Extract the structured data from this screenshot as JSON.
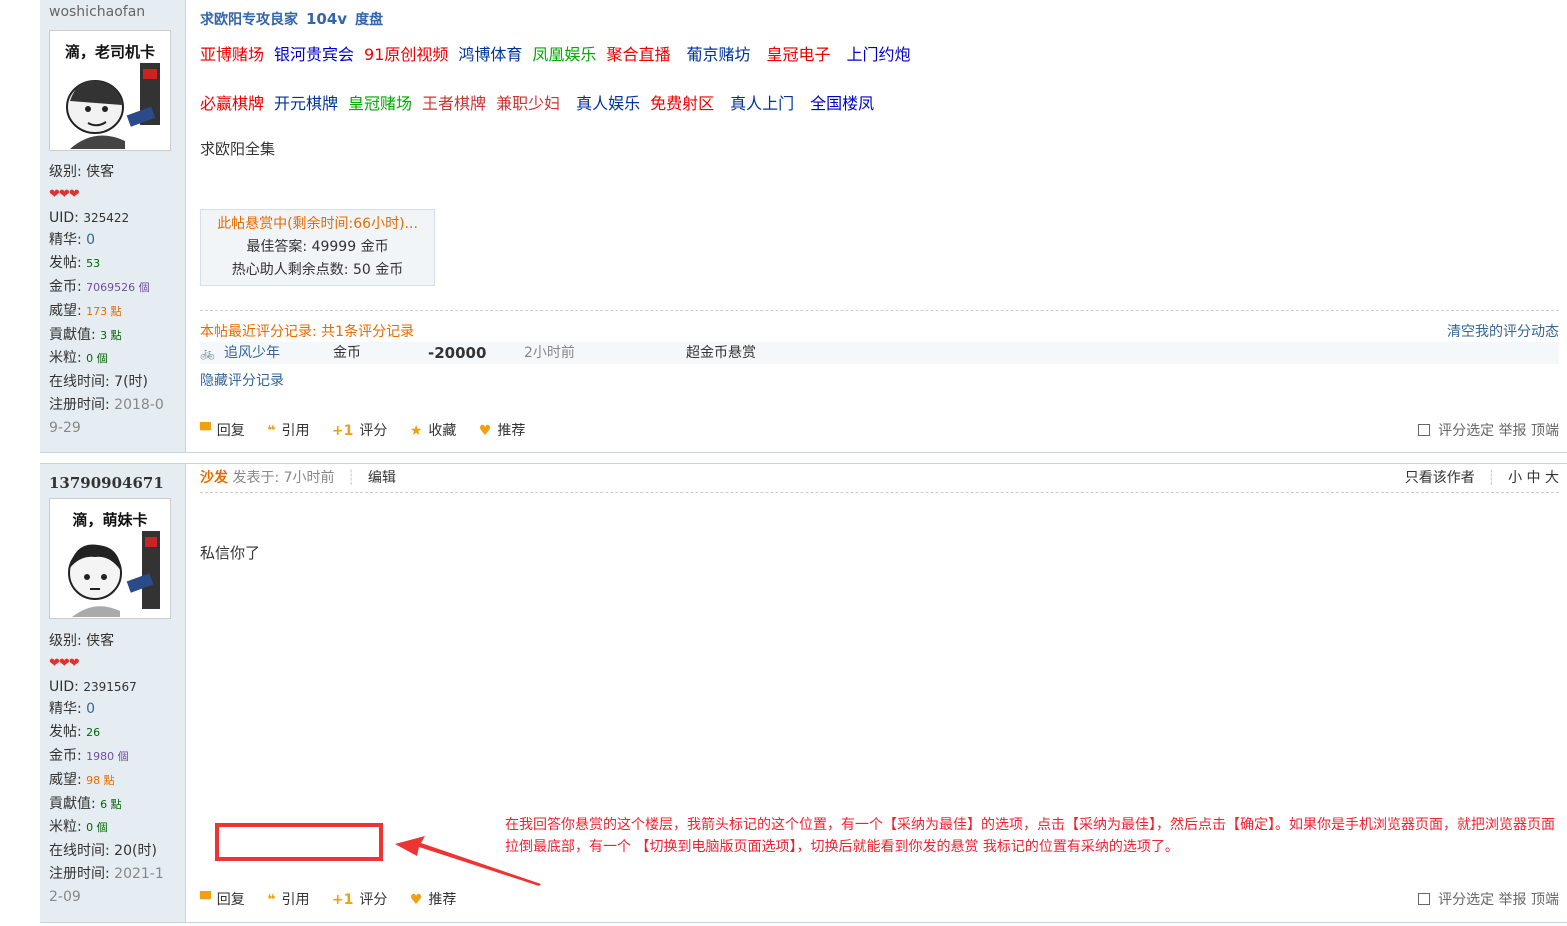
{
  "post1": {
    "username": "woshichaofan",
    "avatar_caption": "滴，老司机卡",
    "stats": {
      "level_label": "级别:",
      "level": "侠客",
      "hearts": "❤❤❤",
      "uid_label": "UID:",
      "uid": "325422",
      "elite_label": "精华:",
      "elite": "0",
      "posts_label": "发帖:",
      "posts": "53",
      "gold_label": "金币:",
      "gold": "7069526 個",
      "prestige_label": "威望:",
      "prestige": "173 點",
      "contrib_label": "貢獻值:",
      "contrib": "3 點",
      "rice_label": "米粒:",
      "rice": "0 個",
      "online_label": "在线时间:",
      "online": "7(时)",
      "reg_label": "注册时间:",
      "reg_part1": "2018-0",
      "reg_part2": "9-29"
    },
    "title": {
      "a": "求欧阳专攻良家",
      "b": "104v",
      "c": "度盘"
    },
    "ads_row1": [
      "亚博赌场",
      "银河贵宾会",
      "91原创视频",
      "鸿博体育",
      "凤凰娱乐",
      "聚合直播",
      "葡京赌坊",
      "皇冠电子",
      "上门约炮"
    ],
    "ads_row2": [
      "必赢棋牌",
      "开元棋牌",
      "皇冠赌场",
      "王者棋牌",
      "兼职少妇",
      "真人娱乐",
      "免费射区",
      "真人上门",
      "全国楼凤"
    ],
    "body": "求欧阳全集",
    "reward": {
      "header": "此帖悬赏中(剩余时间:66小时)...",
      "best": "最佳答案: 49999 金币",
      "helper": "热心助人剩余点数: 50 金币"
    },
    "rating": {
      "header": "本帖最近评分记录: 共1条评分记录",
      "clear": "清空我的评分动态",
      "user": "追风少年",
      "field": "金币",
      "value": "-20000",
      "time": "2小时前",
      "reason": "超金币悬赏",
      "hide": "隐藏评分记录"
    },
    "actions": {
      "reply": "回复",
      "quote": "引用",
      "rate": "评分",
      "fav": "收藏",
      "recommend": "推荐",
      "right": "评分选定 举报 顶端"
    }
  },
  "post2": {
    "username": "13790904671",
    "avatar_caption": "滴，萌妹卡",
    "stats": {
      "level_label": "级别:",
      "level": "侠客",
      "hearts": "❤❤❤",
      "uid_label": "UID:",
      "uid": "2391567",
      "elite_label": "精华:",
      "elite": "0",
      "posts_label": "发帖:",
      "posts": "26",
      "gold_label": "金币:",
      "gold": "1980 個",
      "prestige_label": "威望:",
      "prestige": "98 點",
      "contrib_label": "貢獻值:",
      "contrib": "6 點",
      "rice_label": "米粒:",
      "rice": "0 個",
      "online_label": "在线时间:",
      "online": "20(时)",
      "reg_label": "注册时间:",
      "reg_part1": "2021-1",
      "reg_part2": "2-09"
    },
    "meta": {
      "floor": "沙发",
      "posted": "发表于: 7小时前",
      "edit": "编辑",
      "only_author": "只看该作者",
      "sizes": "小 中 大"
    },
    "body": "私信你了",
    "actions": {
      "reply": "回复",
      "quote": "引用",
      "rate": "评分",
      "recommend": "推荐",
      "right": "评分选定 举报 顶端"
    }
  },
  "annotation": "在我回答你悬赏的这个楼层，我箭头标记的这个位置，有一个【采纳为最佳】的选项，点击【采纳为最佳】，然后点击【确定】。如果你是手机浏览器页面，就把浏览器页面拉倒最底部，有一个 【切换到电脑版页面选项】，切换后就能看到你发的悬赏 我标记的位置有采纳的选项了。",
  "colors": {
    "sidebar_bg": "#e5edf2",
    "link": "#336699",
    "orange": "#e56b00",
    "annotation_red": "#ee2233"
  }
}
